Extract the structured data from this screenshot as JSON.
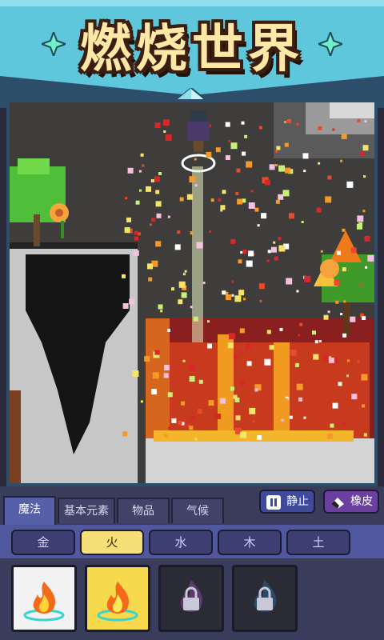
{
  "header": {
    "title": "燃烧世界"
  },
  "controls": {
    "pause_label": "静止",
    "eraser_label": "橡皮"
  },
  "tabs": [
    {
      "label": "魔法",
      "active": true
    },
    {
      "label": "基本元素",
      "active": false
    },
    {
      "label": "物品",
      "active": false
    },
    {
      "label": "气候",
      "active": false
    }
  ],
  "elements": [
    {
      "label": "金",
      "active": false
    },
    {
      "label": "火",
      "active": true
    },
    {
      "label": "水",
      "active": false
    },
    {
      "label": "木",
      "active": false
    },
    {
      "label": "土",
      "active": false
    }
  ],
  "items": [
    {
      "icon": "fire-magic-icon",
      "state": "unlocked",
      "card_color": "#f2f2f2"
    },
    {
      "icon": "fire-magic-icon",
      "state": "selected",
      "card_color": "#f6d94c"
    },
    {
      "icon": "lock-icon",
      "state": "locked",
      "card_color": "#2b2b35"
    },
    {
      "icon": "lock-icon",
      "state": "locked",
      "card_color": "#2b2b35"
    }
  ],
  "colors": {
    "header_bg": "#5ec7dc",
    "title_fill": "#ffe7a6",
    "panel_bg": "#3a3c5c",
    "active_element": "#f6df76"
  }
}
